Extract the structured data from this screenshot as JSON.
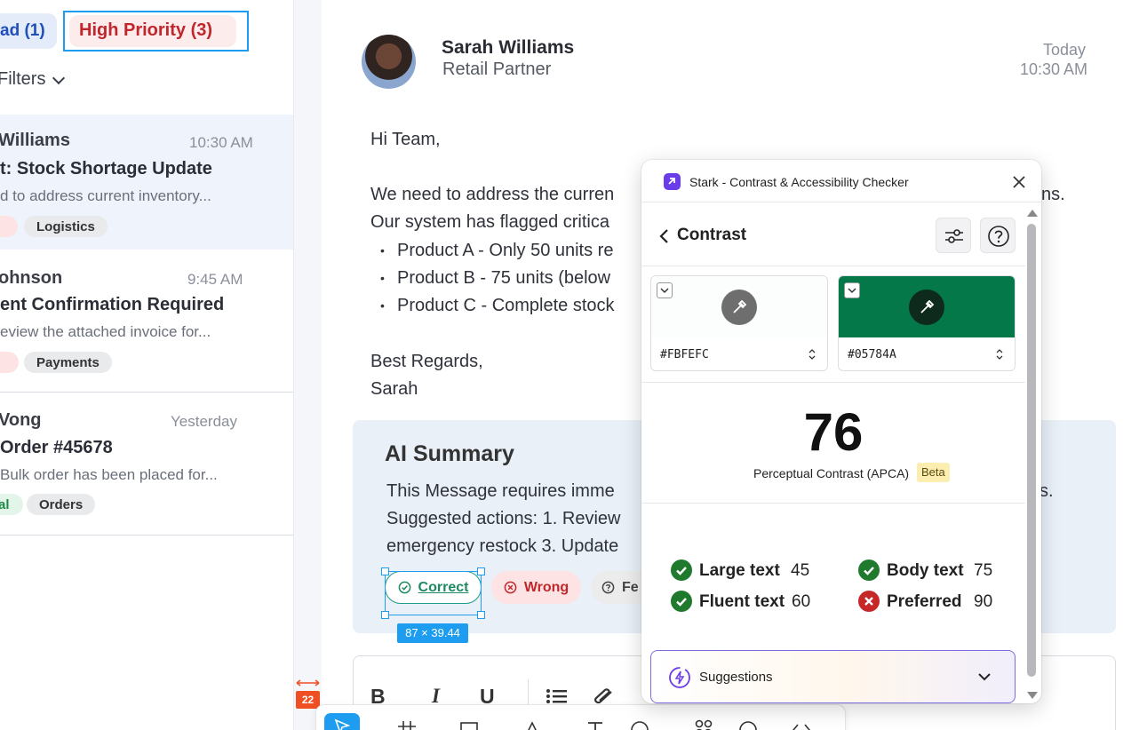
{
  "filters": {
    "unread_label": "ad (1)",
    "high_priority_label": "High Priority (3)",
    "filters_label": "Filters"
  },
  "messages": [
    {
      "sender": "Williams",
      "time": "10:30 AM",
      "subject": "t: Stock Shortage Update",
      "preview": "d to address current inventory...",
      "tags": [
        "",
        "Logistics"
      ]
    },
    {
      "sender": "ohnson",
      "time": "9:45 AM",
      "subject": "ent Confirmation Required",
      "preview": "eview the attached invoice for...",
      "tags": [
        "",
        "Payments"
      ]
    },
    {
      "sender": "Vong",
      "time": "Yesterday",
      "subject": "Order #45678",
      "preview": "Bulk order has been placed for...",
      "tags": [
        "al",
        "Orders"
      ]
    }
  ],
  "email": {
    "sender_name": "Sarah Williams",
    "sender_role": "Retail Partner",
    "date": "Today",
    "time": "10:30 AM",
    "greeting": "Hi Team,",
    "line1": "We need to address the curren",
    "line1_tail": "ns.",
    "line2": "Our system has flagged critica",
    "bullets": [
      "Product A - Only 50 units re",
      "Product B - 75 units (below",
      "Product C - Complete stock"
    ],
    "sign_off": "Best Regards,",
    "signature": "Sarah"
  },
  "ai_summary": {
    "title": "AI Summary",
    "line1": "This Message requires imme",
    "line1_tail": "s.",
    "line2": "Suggested actions: 1. Review",
    "line3": "emergency restock 3. Update",
    "correct_label": "Correct",
    "wrong_label": "Wrong",
    "feedback_label": "Fe"
  },
  "selection": {
    "dimensions": "87 × 39.44",
    "spacing": "22"
  },
  "reply_toolbar": {
    "bold": "B",
    "italic": "I",
    "underline": "U"
  },
  "stark": {
    "title": "Stark - Contrast & Accessibility Checker",
    "section": "Contrast",
    "foreground_hex": "#FBFEFC",
    "background_hex": "#05784A",
    "foreground_color": "#FBFEFC",
    "background_color": "#05784A",
    "score": "76",
    "score_label": "Perceptual Contrast (APCA)",
    "beta_label": "Beta",
    "results": [
      {
        "label": "Large text",
        "value": "45",
        "pass": true
      },
      {
        "label": "Body text",
        "value": "75",
        "pass": true
      },
      {
        "label": "Fluent text",
        "value": "60",
        "pass": true
      },
      {
        "label": "Preferred",
        "value": "90",
        "pass": false
      }
    ],
    "suggestions_label": "Suggestions"
  },
  "colors": {
    "accent_blue": "#1e9df0",
    "pass_green": "#1f7a2e",
    "fail_red": "#c62828",
    "brand_purple": "#6a3de8"
  }
}
